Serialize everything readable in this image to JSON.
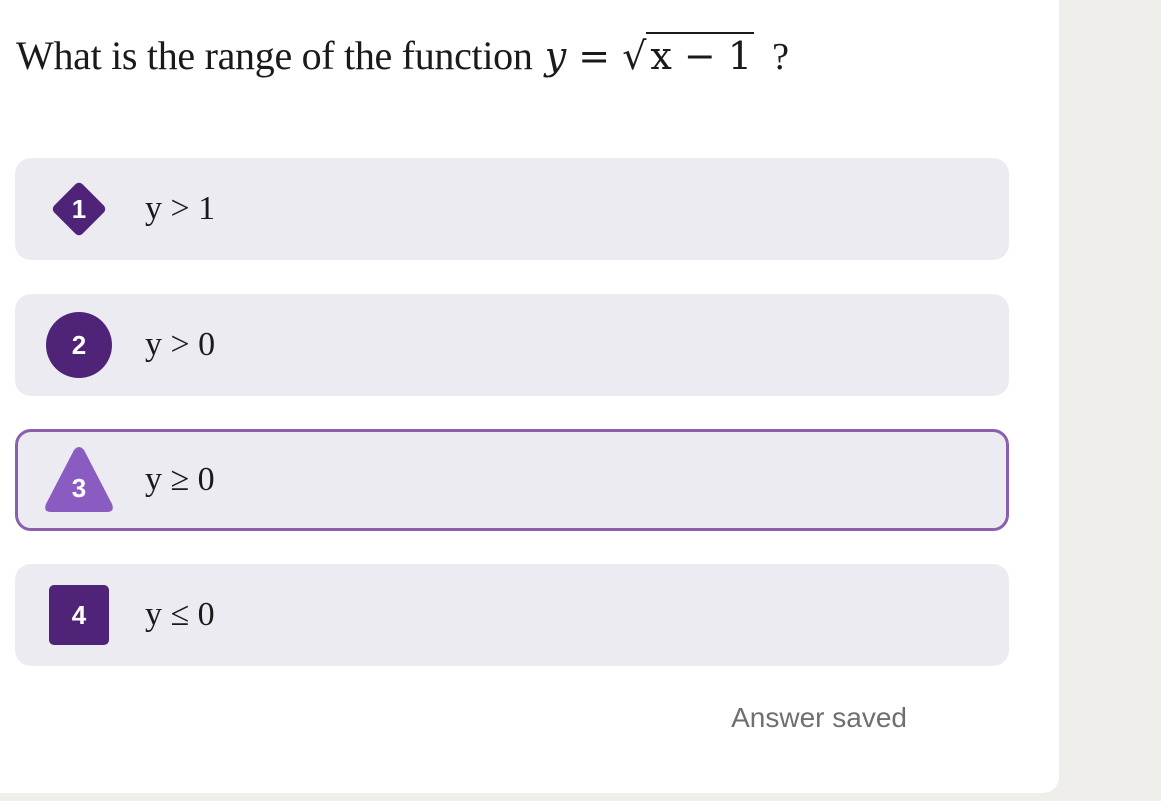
{
  "question": {
    "text": "What is the range of the function",
    "y_var": "y",
    "equals": "=",
    "sqrt_symbol": "√",
    "radicand": "x − 1",
    "question_mark": "?"
  },
  "options": [
    {
      "number": "1",
      "label": "y > 1",
      "shape": "diamond",
      "color": "#4f2478",
      "selected": false
    },
    {
      "number": "2",
      "label": "y > 0",
      "shape": "circle",
      "color": "#4f2478",
      "selected": false
    },
    {
      "number": "3",
      "label": "y ≥ 0",
      "shape": "triangle",
      "color": "#8a5cc2",
      "selected": true
    },
    {
      "number": "4",
      "label": "y ≤ 0",
      "shape": "square",
      "color": "#4f2478",
      "selected": false
    }
  ],
  "status_text": "Answer saved",
  "colors": {
    "option_bg": "#ecebf2",
    "selected_border": "#8a5fae",
    "badge_dark": "#4f2478",
    "badge_light": "#8a5cc2",
    "status_text": "#6f6f6f"
  }
}
